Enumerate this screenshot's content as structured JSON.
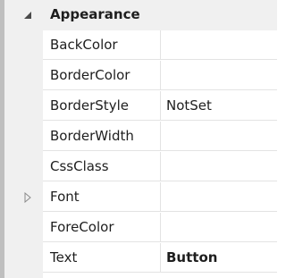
{
  "property_grid": {
    "category": {
      "label": "Appearance",
      "expander_icon": "triangle-expanded-icon"
    },
    "properties": [
      {
        "name": "BackColor",
        "value": ""
      },
      {
        "name": "BorderColor",
        "value": ""
      },
      {
        "name": "BorderStyle",
        "value": "NotSet"
      },
      {
        "name": "BorderWidth",
        "value": ""
      },
      {
        "name": "CssClass",
        "value": ""
      },
      {
        "name": "Font",
        "value": "",
        "expander_icon": "triangle-collapsed-icon"
      },
      {
        "name": "ForeColor",
        "value": ""
      },
      {
        "name": "Text",
        "value": "Button"
      }
    ]
  },
  "colors": {
    "gutter": "#f0f0f0",
    "grid_lines": "#e3e3e3",
    "left_border": "#bfbfbf",
    "expander": "#8a8a8a"
  }
}
